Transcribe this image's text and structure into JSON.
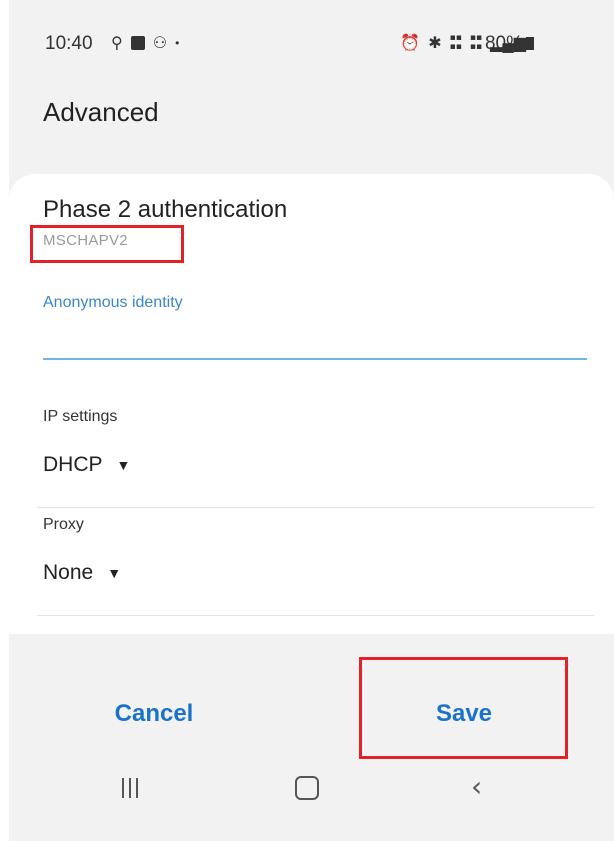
{
  "status_bar": {
    "time": "10:40",
    "left_icons": [
      "location-icon",
      "linkedin-icon",
      "dot-icon"
    ],
    "right_icons": [
      "alarm-icon",
      "bluetooth-icon",
      "volte-icon",
      "4g-icon",
      "signal-icon"
    ],
    "battery": "80%"
  },
  "page": {
    "title": "Advanced"
  },
  "phase2": {
    "label": "Phase 2 authentication",
    "value": "MSCHAPV2"
  },
  "anonymous_identity": {
    "label": "Anonymous identity",
    "value": "",
    "placeholder": ""
  },
  "ip_settings": {
    "label": "IP settings",
    "selected": "DHCP"
  },
  "proxy": {
    "label": "Proxy",
    "selected": "None"
  },
  "actions": {
    "cancel_label": "Cancel",
    "save_label": "Save"
  },
  "colors": {
    "accent": "#1a73c9",
    "highlight": "#e0232a"
  }
}
